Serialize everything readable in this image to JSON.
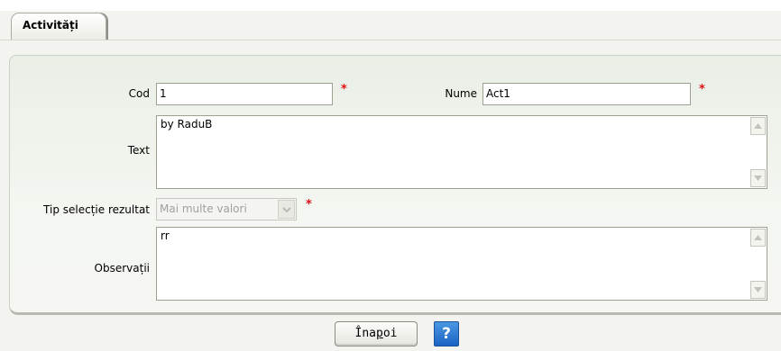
{
  "tabs": [
    {
      "label": "Activități",
      "active": true
    }
  ],
  "form": {
    "cod": {
      "label": "Cod",
      "value": "1",
      "required_mark": "*"
    },
    "nume": {
      "label": "Nume",
      "value": "Act1",
      "required_mark": "*"
    },
    "text": {
      "label": "Text",
      "value": "by RaduB"
    },
    "tip_selectie": {
      "label": "Tip selecție rezultat",
      "value": "Mai multe valori",
      "disabled": true,
      "required_mark": "*"
    },
    "observatii": {
      "label": "Observații",
      "value": "rr"
    }
  },
  "footer": {
    "back_button": "Înapoi",
    "back_button_accesskey": "p",
    "help_button": "?"
  },
  "colors": {
    "required": "#dd1111",
    "panel_bg": "#f4f6f1",
    "help_bg": "#1b62c4"
  }
}
